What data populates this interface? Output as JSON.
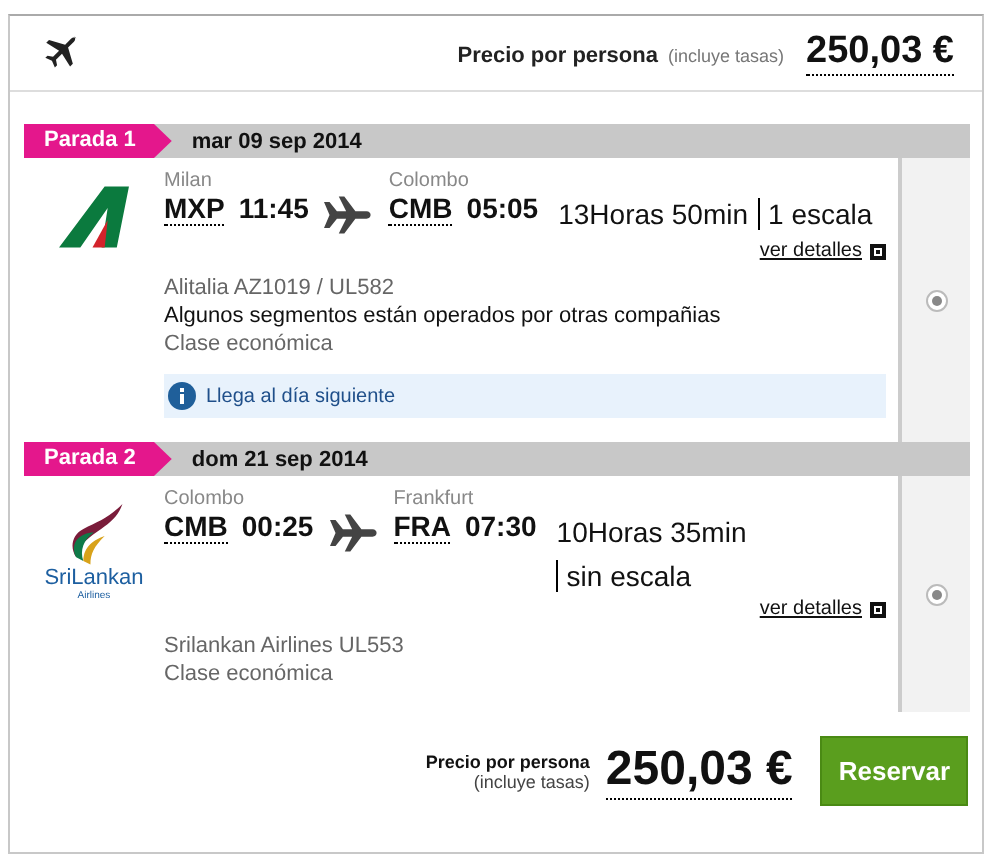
{
  "header": {
    "price_label": "Precio por persona",
    "price_note": "(incluye tasas)",
    "price": "250,03 €"
  },
  "segments": [
    {
      "tag": "Parada 1",
      "date": "mar 09 sep 2014",
      "logo": {
        "kind": "alitalia"
      },
      "from_city": "Milan",
      "from_code": "MXP",
      "from_time": "11:45",
      "to_city": "Colombo",
      "to_code": "CMB",
      "to_time": "05:05",
      "duration": "13Horas 50min",
      "stops": "1 escala",
      "details": "ver detalles",
      "flight": "Alitalia AZ1019 / UL582",
      "note": "Algunos segmentos están operados por otras compañias",
      "cabin": "Clase económica",
      "info": "Llega al día siguiente",
      "selected": true
    },
    {
      "tag": "Parada 2",
      "date": "dom 21 sep 2014",
      "logo": {
        "kind": "srilankan",
        "text": "SriLankan",
        "subtext": "Airlines"
      },
      "from_city": "Colombo",
      "from_code": "CMB",
      "from_time": "00:25",
      "to_city": "Frankfurt",
      "to_code": "FRA",
      "to_time": "07:30",
      "duration": "10Horas 35min",
      "stops": "sin escala",
      "details": "ver detalles",
      "flight": "Srilankan Airlines UL553",
      "cabin": "Clase económica",
      "selected": true
    }
  ],
  "footer": {
    "price_label": "Precio por persona",
    "price_note": "(incluye tasas)",
    "price": "250,03 €",
    "button": "Reservar"
  }
}
